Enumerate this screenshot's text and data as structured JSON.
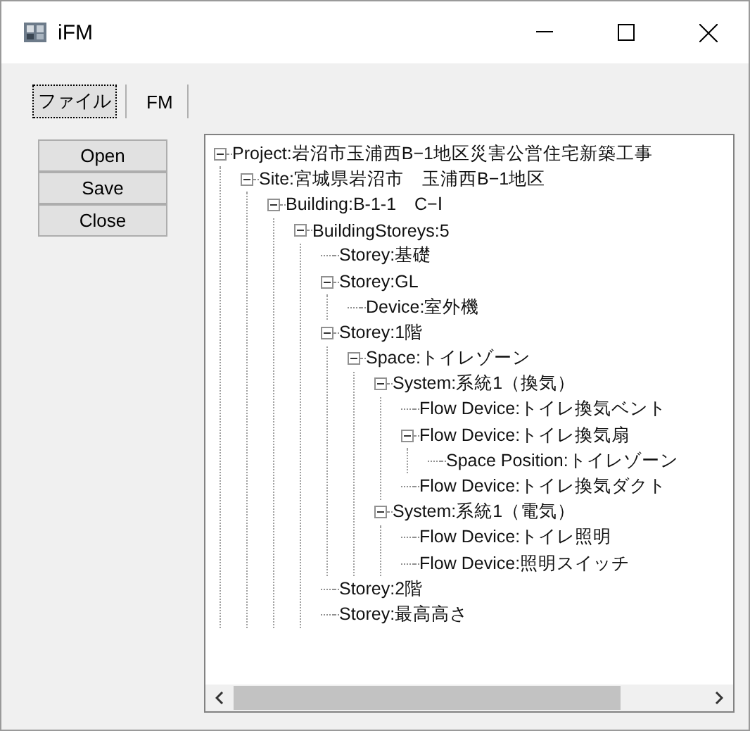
{
  "window": {
    "title": "iFM"
  },
  "tabs": [
    {
      "label": "ファイル",
      "selected": true
    },
    {
      "label": "FM",
      "selected": false
    }
  ],
  "buttons": [
    "Open",
    "Save",
    "Close"
  ],
  "tree": [
    {
      "label": "Project:岩沼市玉浦西B−1地区災害公営住宅新築工事",
      "expanded": true,
      "children": [
        {
          "label": "Site:宮城県岩沼市　玉浦西B−1地区",
          "expanded": true,
          "children": [
            {
              "label": "Building:B-1-1　C−Ⅰ",
              "expanded": true,
              "children": [
                {
                  "label": "BuildingStoreys:5",
                  "expanded": true,
                  "children": [
                    {
                      "label": "Storey:基礎"
                    },
                    {
                      "label": "Storey:GL",
                      "expanded": true,
                      "children": [
                        {
                          "label": "Device:室外機"
                        }
                      ]
                    },
                    {
                      "label": "Storey:1階",
                      "expanded": true,
                      "children": [
                        {
                          "label": "Space:トイレゾーン",
                          "expanded": true,
                          "children": [
                            {
                              "label": "System:系統1（換気）",
                              "expanded": true,
                              "children": [
                                {
                                  "label": "Flow Device:トイレ換気ベント"
                                },
                                {
                                  "label": "Flow Device:トイレ換気扇",
                                  "expanded": true,
                                  "children": [
                                    {
                                      "label": "Space Position:トイレゾーン"
                                    }
                                  ]
                                },
                                {
                                  "label": "Flow Device:トイレ換気ダクト"
                                }
                              ]
                            },
                            {
                              "label": "System:系統1（電気）",
                              "expanded": true,
                              "children": [
                                {
                                  "label": "Flow Device:トイレ照明"
                                },
                                {
                                  "label": "Flow Device:照明スイッチ"
                                }
                              ]
                            }
                          ]
                        }
                      ]
                    },
                    {
                      "label": "Storey:2階"
                    },
                    {
                      "label": "Storey:最高高さ"
                    }
                  ]
                }
              ]
            }
          ]
        }
      ]
    }
  ]
}
